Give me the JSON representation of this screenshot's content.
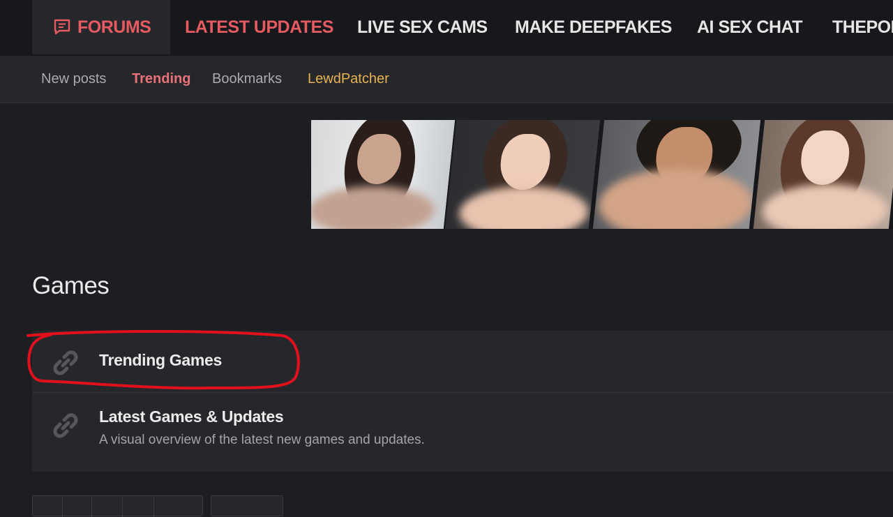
{
  "topnav": {
    "items": [
      {
        "label": "FORUMS",
        "icon": "forum-icon"
      },
      {
        "label": "LATEST UPDATES"
      },
      {
        "label": "LIVE SEX CAMS"
      },
      {
        "label": "MAKE DEEPFAKES"
      },
      {
        "label": "AI SEX CHAT"
      },
      {
        "label": "THEPOR"
      }
    ]
  },
  "subnav": {
    "items": [
      {
        "label": "New posts"
      },
      {
        "label": "Trending"
      },
      {
        "label": "Bookmarks"
      },
      {
        "label": "LewdPatcher"
      }
    ]
  },
  "section": {
    "title": "Games"
  },
  "nodes": [
    {
      "title": "Trending Games",
      "icon": "link-icon"
    },
    {
      "title": "Latest Games & Updates",
      "description": "A visual overview of the latest new games and updates.",
      "icon": "link-icon"
    }
  ],
  "colors": {
    "accent": "#e65a61",
    "highlight": "#e7b24f",
    "annotation": "#e0101c"
  }
}
